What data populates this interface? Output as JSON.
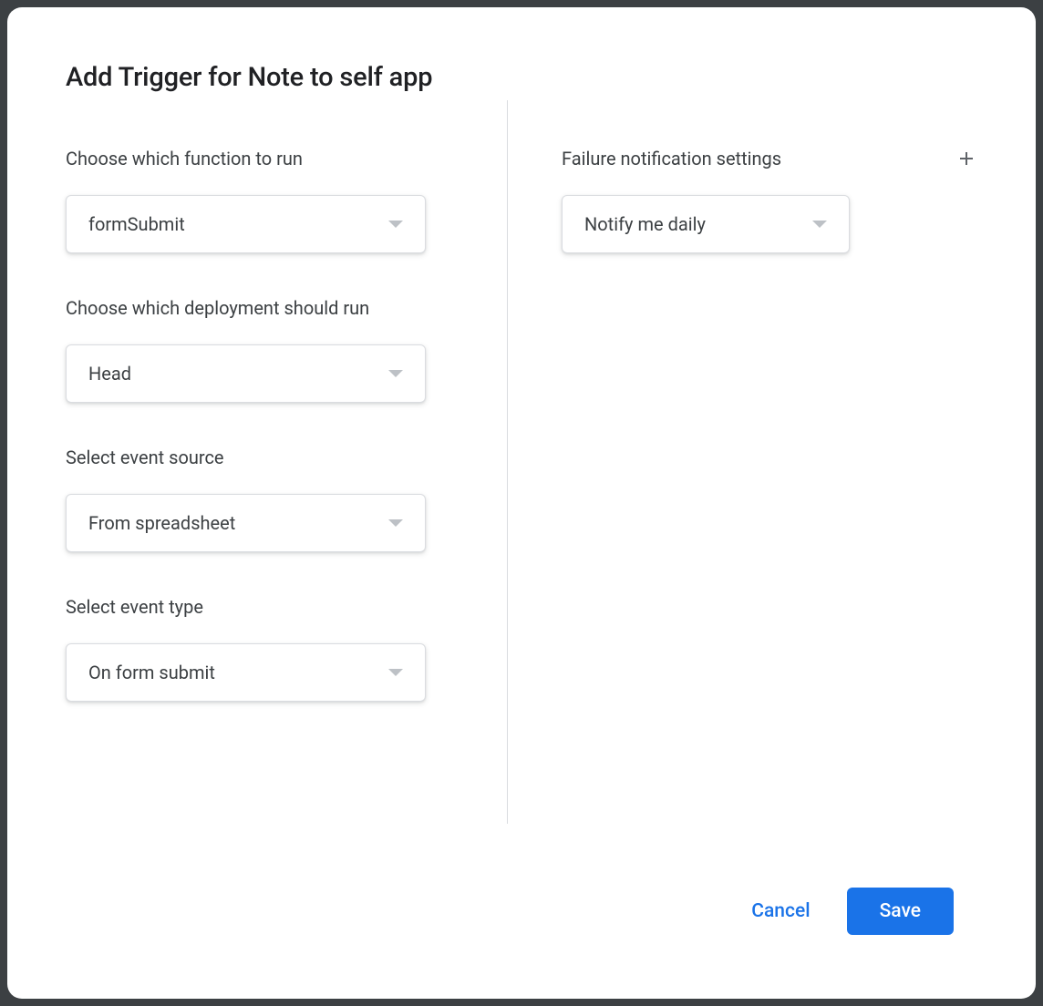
{
  "dialog": {
    "title": "Add Trigger for Note to self app"
  },
  "left": {
    "function": {
      "label": "Choose which function to run",
      "value": "formSubmit"
    },
    "deployment": {
      "label": "Choose which deployment should run",
      "value": "Head"
    },
    "eventSource": {
      "label": "Select event source",
      "value": "From spreadsheet"
    },
    "eventType": {
      "label": "Select event type",
      "value": "On form submit"
    }
  },
  "right": {
    "failureSettings": {
      "label": "Failure notification settings",
      "value": "Notify me daily"
    }
  },
  "footer": {
    "cancel": "Cancel",
    "save": "Save"
  }
}
